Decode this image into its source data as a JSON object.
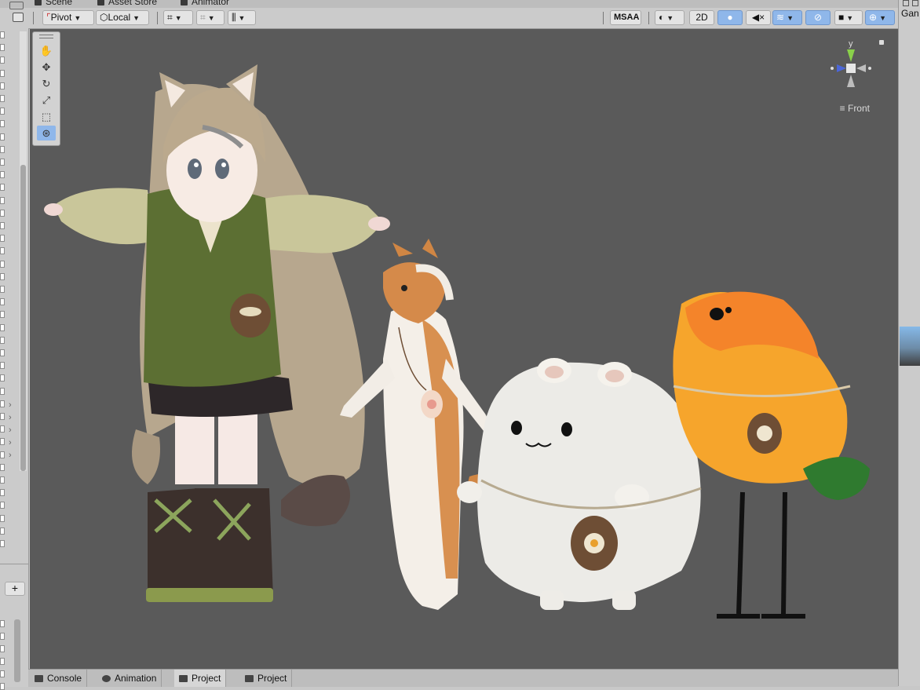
{
  "tabs": {
    "scene": "Scene",
    "asset_store": "Asset Store",
    "animator": "Animator",
    "game": "Gan"
  },
  "toolbar": {
    "pivot": "Pivot",
    "local": "Local",
    "msaa": "MSAA",
    "mode_2d": "2D",
    "icons": [
      "grid-snap-icon",
      "increment-snap-icon",
      "ruler-icon",
      "shading-mode-icon",
      "lighting-icon",
      "audio-icon",
      "effects-icon",
      "hidden-objects-icon",
      "camera-icon",
      "gizmos-icon"
    ]
  },
  "tools": [
    "hand-tool-icon",
    "move-tool-icon",
    "rotate-tool-icon",
    "scale-tool-icon",
    "rect-tool-icon",
    "transform-tool-icon"
  ],
  "gizmo": {
    "axis_y": "y",
    "view_label": "Front"
  },
  "bottom_tabs": [
    "Console",
    "Animation",
    "Project",
    "Project"
  ],
  "left_panel": {
    "add_label": "+"
  },
  "colors": {
    "viewport": "#5a5a5a",
    "active_blue": "#8fb7ea",
    "panel": "#cbcbcb"
  }
}
